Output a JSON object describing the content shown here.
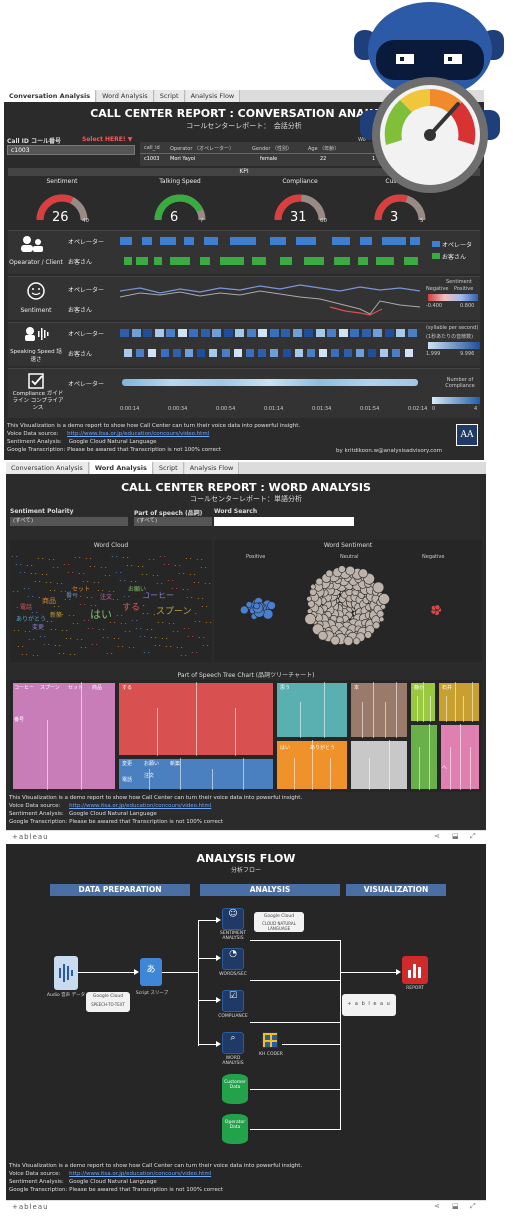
{
  "tabs1": [
    "Conversation Analysis",
    "Word Analysis",
    "Script",
    "Analysis Flow"
  ],
  "tabs2": [
    "Conversation Analysis",
    "Word Analysis",
    "Script",
    "Analysis Flow"
  ],
  "conv": {
    "title": "CALL CENTER REPORT :  CONVERSATION ANALYSIS",
    "subtitle": "コールセンターレポート：　会話分析",
    "call_id_label": "Call ID コール番号",
    "select_here": "Select HERE! ▼",
    "call_id_value": "c1003",
    "table_headers": [
      "call_id",
      "Operator （オペレーター）",
      "Gender （性別）",
      "Age （年齢）",
      "Wo"
    ],
    "table_row": [
      "c1003",
      "Mori Yayoi",
      "female",
      "22",
      "1"
    ],
    "kpi_header": "KPI",
    "kpis": [
      {
        "label": "Sentiment",
        "value": "26",
        "max": "40",
        "color": "#d84040",
        "fill": 0.65
      },
      {
        "label": "Talking Speed",
        "value": "6",
        "max": "7",
        "color": "#3aab40",
        "fill": 0.86
      },
      {
        "label": "Compliance",
        "value": "31",
        "max": "60",
        "color": "#d84040",
        "fill": 0.52
      },
      {
        "label": "Customer",
        "value": "3",
        "max": "5",
        "color": "#d84040",
        "fill": 0.6
      }
    ],
    "rows": [
      {
        "label": "Opearator / Client",
        "icon": "operator-client-icon"
      },
      {
        "label": "Sentiment",
        "icon": "smile-icon"
      },
      {
        "label": "Speaking Speed 話速さ",
        "icon": "speaking-icon"
      },
      {
        "label": "Compliance ガイドライン コンプライアンス",
        "icon": "checkbox-icon"
      }
    ],
    "speaker_op": "オペレーター",
    "speaker_cl": "お客さん",
    "legend_op": "オペレータ",
    "legend_cl": "お客さん",
    "sent_legend_title": "Sentiment",
    "sent_neg": "Negative",
    "sent_pos": "Positive",
    "sent_min": "-0.400",
    "sent_max": "0.800",
    "speed_legend_title": "(syllable per second)",
    "speed_legend_sub": "(1秒あたりの音節数)",
    "speed_min": "1.999",
    "speed_max": "9.996",
    "comp_legend_title": "Number of Compliance",
    "comp_min": "0",
    "comp_max": "4",
    "timeline": [
      "0:00:14",
      "0:00:34",
      "0:00:54",
      "0:01:14",
      "0:01:34",
      "0:01:54",
      "0:02:14"
    ],
    "byline": "by kritdikoon.w@analysisadvisory.com",
    "logo": "AA"
  },
  "footer": {
    "line1": "This Visualization is a demo report to show how Call Center can turn their voice data into powerful insight.",
    "voice_label": "Voice Data source:",
    "voice_link": "http://www.itsa.or.jp/education/concours/video.html",
    "sentiment_label": "Sentiment Analysis:",
    "sentiment_value": "Google Cloud Natural Language",
    "trans_label": "Google Transcription:",
    "trans_value": "Please be awared that Transcription is not 100% correct"
  },
  "word": {
    "title": "CALL CENTER REPORT : WORD ANALYSIS",
    "subtitle": "コールセンターレポート：単語分析",
    "filter1_label": "Sentiment Polarity",
    "filter1_value": "(すべて)",
    "filter2_label": "Part of speech (品詞)",
    "filter2_value": "(すべて)",
    "filter3_label": "Word Search",
    "filter3_value": "",
    "cloud_title": "Word Cloud",
    "sentiment_title": "Word Sentiment",
    "pos": "Positive",
    "neu": "Neutral",
    "neg": "Negative",
    "cloud_words": [
      "商品",
      "はい",
      "する",
      "コーヒー",
      "スプーン",
      "ありがとう",
      "番号",
      "注文",
      "セット",
      "お願い",
      "電話",
      "変更",
      "新築"
    ],
    "tree_title": "Part of Speech Tree Chart (品詞ツリーチャート)",
    "tree_labels": [
      "コーヒー",
      "スプーン",
      "セット",
      "商品",
      "番号",
      "する",
      "思う",
      "本",
      "静か",
      "石井",
      "変更",
      "お願い",
      "新築",
      "注文",
      "電話",
      "はい",
      "ありがとう",
      "へ"
    ]
  },
  "flow": {
    "title": "ANALYSIS FLOW",
    "subtitle": "分析フロー",
    "sec1": "DATA PREPARATION",
    "sec2": "ANALYSIS",
    "sec3": "VISUALIZATION",
    "audio": "Audio 音声 データ",
    "stt": "SPEECH-TO-TEXT",
    "gcloud": "Google Cloud",
    "script": "Script スリープ",
    "nl": "CLOUD NATURAL LANGUAGE",
    "a1": "SENTIMENT ANALYSIS",
    "a2": "WORDS/SEC",
    "a3": "COMPLIANCE",
    "a4": "WORD ANALYSIS",
    "khcoder": "KH CODER",
    "cust": "Customer Data",
    "oper": "Operator Data",
    "report": "REPORT",
    "tableau": "+ a b l e a u"
  },
  "tableau_logo": "+ableau"
}
